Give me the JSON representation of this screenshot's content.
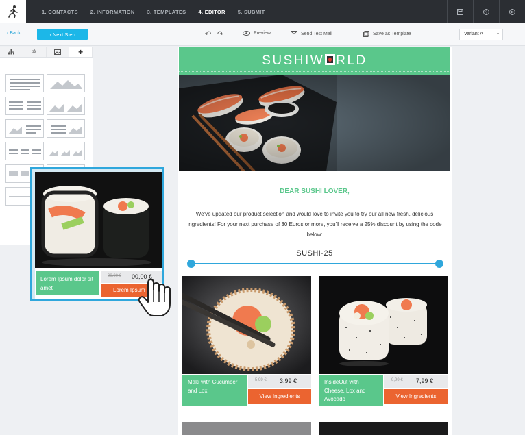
{
  "nav": {
    "steps": [
      "1. CONTACTS",
      "2. INFORMATION",
      "3. TEMPLATES",
      "4. EDITOR",
      "5. SUBMIT"
    ],
    "active_step": "4. EDITOR",
    "icons": [
      "save-icon",
      "help-icon",
      "close-icon"
    ]
  },
  "toolbar": {
    "back_label": "Back",
    "next_label": "Next Step",
    "preview_label": "Preview",
    "send_test_label": "Send Test Mail",
    "save_template_label": "Save as Template",
    "variant_value": "Variant A"
  },
  "panel": {
    "tabs": [
      "structure-icon",
      "settings-icon",
      "image-icon",
      "add-icon"
    ]
  },
  "dragged_module": {
    "label": "Lorem Ipsum dolor sit amet",
    "old_price": "00,00 €",
    "price": "00,00 €",
    "button": "Lorem Ipsum"
  },
  "email": {
    "brand": "SUSHIW",
    "brand_end": "RLD",
    "greeting": "DEAR SUSHI LOVER,",
    "body": "We've updated our product selection and would love to invite you to try our all new fresh, delicious ingredients! For your next purchase of 30 Euros or more, you'll receive a 25% discount by using the code below:",
    "code": "SUSHI-25",
    "products": [
      {
        "name": "Maki with Cucumber and Lox",
        "old_price": "5,99 €",
        "price": "3,99 €",
        "button": "View Ingredients"
      },
      {
        "name": "InsideOut with Cheese, Lox and Avocado",
        "old_price": "9,99 €",
        "price": "7,99 €",
        "button": "View Ingredients"
      }
    ]
  },
  "colors": {
    "green": "#5ac78b",
    "orange": "#eb6430",
    "blue": "#2fa7dc",
    "nav_bg": "#2b2e33"
  }
}
